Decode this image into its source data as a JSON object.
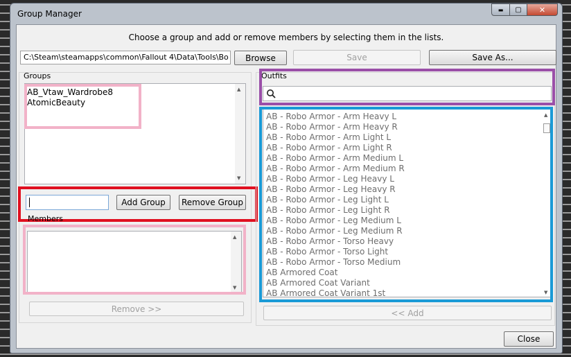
{
  "window": {
    "title": "Group Manager",
    "minimize_label": "▬",
    "maximize_label": "▢",
    "close_label": "✕"
  },
  "instructions": "Choose a group and add or remove members by selecting them in the lists.",
  "path_field": {
    "value": "C:\\Steam\\steamapps\\common\\Fallout 4\\Data\\Tools\\Bo"
  },
  "toolbar": {
    "browse_label": "Browse",
    "save_label": "Save",
    "save_as_label": "Save As..."
  },
  "groups": {
    "label": "Groups",
    "items": [
      "AB_Vtaw_Wardrobe8",
      "AtomicBeauty"
    ],
    "add_label": "Add Group",
    "remove_label": "Remove Group",
    "name_input_value": ""
  },
  "members": {
    "label": "Members",
    "remove_label": "Remove >>"
  },
  "outfits": {
    "label": "Outfits",
    "search_value": "",
    "items": [
      "AB - Robo Armor - Arm Heavy L",
      "AB - Robo Armor - Arm Heavy R",
      "AB - Robo Armor - Arm Light L",
      "AB - Robo Armor - Arm Light R",
      "AB - Robo Armor - Arm Medium L",
      "AB - Robo Armor - Arm Medium R",
      "AB - Robo Armor - Leg Heavy L",
      "AB - Robo Armor - Leg Heavy R",
      "AB - Robo Armor - Leg Light L",
      "AB - Robo Armor - Leg Light R",
      "AB - Robo Armor - Leg Medium L",
      "AB - Robo Armor - Leg Medium R",
      "AB - Robo Armor - Torso Heavy",
      "AB - Robo Armor - Torso Light",
      "AB - Robo Armor - Torso Medium",
      "AB Armored Coat",
      "AB Armored Coat Variant",
      "AB Armored Coat Variant 1st"
    ],
    "add_label": "<< Add"
  },
  "footer": {
    "close_label": "Close"
  },
  "colors": {
    "highlight_pink": "#f2b2c8",
    "highlight_red": "#e01020",
    "highlight_purple": "#9a4fa8",
    "highlight_blue": "#1a9ad6"
  }
}
